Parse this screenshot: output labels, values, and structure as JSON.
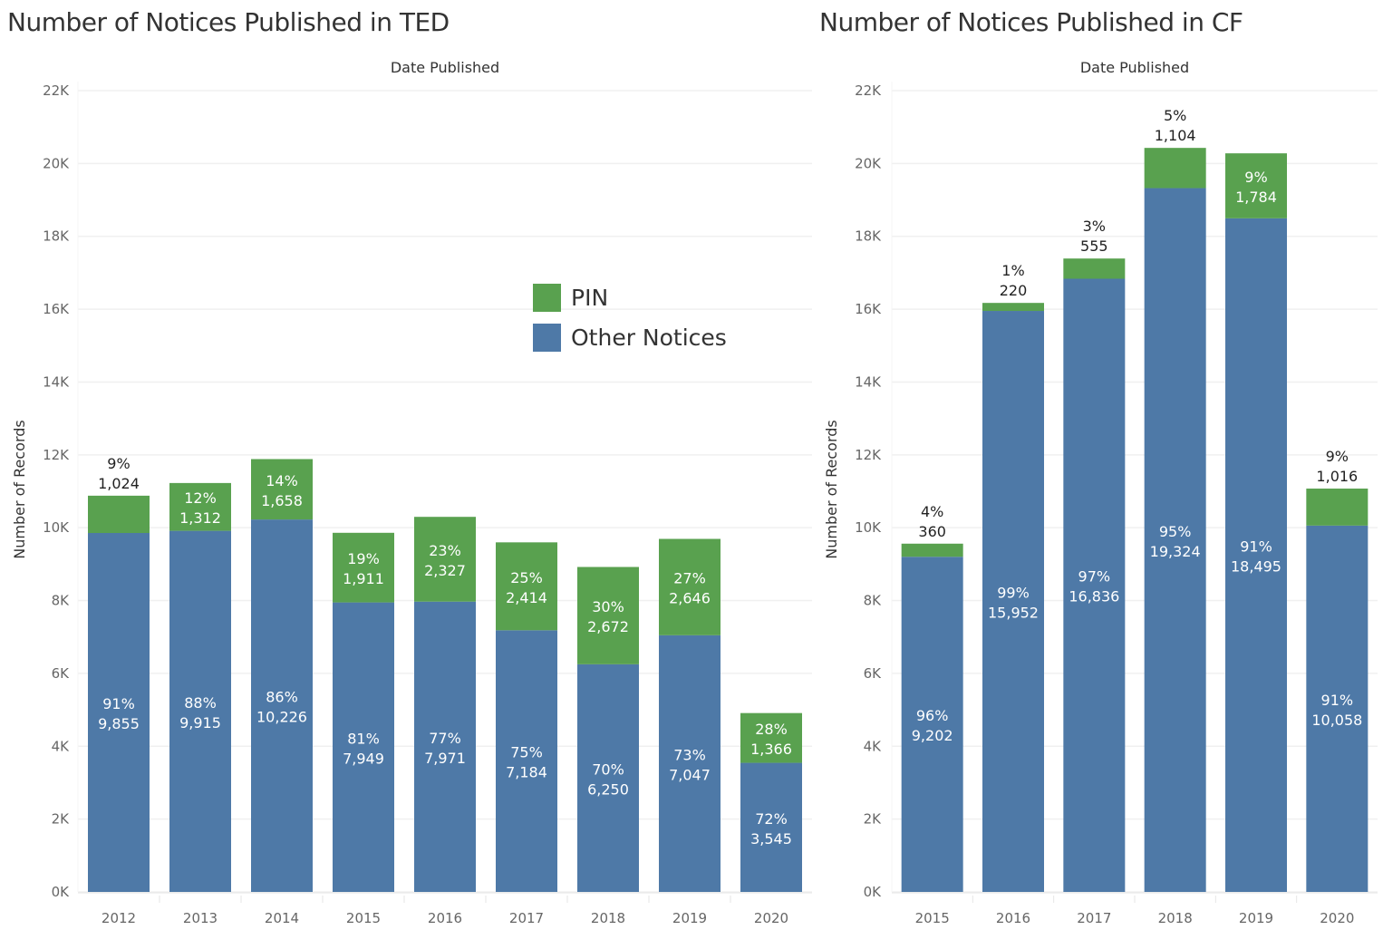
{
  "colors": {
    "pin": "#59a14f",
    "other": "#4e79a7"
  },
  "legend": [
    {
      "key": "pin",
      "label": "PIN"
    },
    {
      "key": "other",
      "label": "Other Notices"
    }
  ],
  "chart_data": [
    {
      "id": "ted",
      "type": "bar",
      "stacked": true,
      "title": "Number of Notices Published in TED",
      "xlabel": "Date Published",
      "ylabel": "Number of Records",
      "ylim": [
        0,
        22000
      ],
      "yticks": [
        0,
        2000,
        4000,
        6000,
        8000,
        10000,
        12000,
        14000,
        16000,
        18000,
        20000,
        22000
      ],
      "ytick_labels": [
        "0K",
        "2K",
        "4K",
        "6K",
        "8K",
        "10K",
        "12K",
        "14K",
        "16K",
        "18K",
        "20K",
        "22K"
      ],
      "grid": true,
      "legend_position": "upper-right",
      "categories": [
        "2012",
        "2013",
        "2014",
        "2015",
        "2016",
        "2017",
        "2018",
        "2019",
        "2020"
      ],
      "series": [
        {
          "name": "Other Notices",
          "key": "other",
          "values": [
            9855,
            9915,
            10226,
            7949,
            7971,
            7184,
            6250,
            7047,
            3545
          ],
          "labels": [
            "9,855",
            "9,915",
            "10,226",
            "7,949",
            "7,971",
            "7,184",
            "6,250",
            "7,047",
            "3,545"
          ],
          "percents": [
            "91%",
            "88%",
            "86%",
            "81%",
            "77%",
            "75%",
            "70%",
            "73%",
            "72%"
          ]
        },
        {
          "name": "PIN",
          "key": "pin",
          "values": [
            1024,
            1312,
            1658,
            1911,
            2327,
            2414,
            2672,
            2646,
            1366
          ],
          "labels": [
            "1,024",
            "1,312",
            "1,658",
            "1,911",
            "2,327",
            "2,414",
            "2,672",
            "2,646",
            "1,366"
          ],
          "percents": [
            "9%",
            "12%",
            "14%",
            "19%",
            "23%",
            "25%",
            "30%",
            "27%",
            "28%"
          ]
        }
      ]
    },
    {
      "id": "cf",
      "type": "bar",
      "stacked": true,
      "title": "Number of Notices Published in CF",
      "xlabel": "Date Published",
      "ylabel": "Number of Records",
      "ylim": [
        0,
        22000
      ],
      "yticks": [
        0,
        2000,
        4000,
        6000,
        8000,
        10000,
        12000,
        14000,
        16000,
        18000,
        20000,
        22000
      ],
      "ytick_labels": [
        "0K",
        "2K",
        "4K",
        "6K",
        "8K",
        "10K",
        "12K",
        "14K",
        "16K",
        "18K",
        "20K",
        "22K"
      ],
      "grid": true,
      "categories": [
        "2015",
        "2016",
        "2017",
        "2018",
        "2019",
        "2020"
      ],
      "series": [
        {
          "name": "Other Notices",
          "key": "other",
          "values": [
            9202,
            15952,
            16836,
            19324,
            18495,
            10058
          ],
          "labels": [
            "9,202",
            "15,952",
            "16,836",
            "19,324",
            "18,495",
            "10,058"
          ],
          "percents": [
            "96%",
            "99%",
            "97%",
            "95%",
            "91%",
            "91%"
          ]
        },
        {
          "name": "PIN",
          "key": "pin",
          "values": [
            360,
            220,
            555,
            1104,
            1784,
            1016
          ],
          "labels": [
            "360",
            "220",
            "555",
            "1,104",
            "1,784",
            "1,016"
          ],
          "percents": [
            "4%",
            "1%",
            "3%",
            "5%",
            "9%",
            "9%"
          ]
        }
      ]
    }
  ]
}
